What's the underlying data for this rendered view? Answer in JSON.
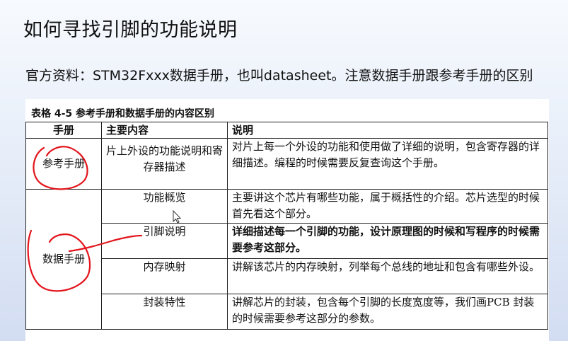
{
  "slide": {
    "title": "如何寻找引脚的功能说明",
    "subtitle": "官方资料：STM32Fxxx数据手册，也叫datasheet。注意数据手册跟参考手册的区别"
  },
  "table": {
    "caption": "表格 4-5 参考手册和数据手册的内容区别",
    "headers": [
      "手册",
      "主要内容",
      "说明"
    ],
    "rows": [
      {
        "manual": "参考手册",
        "content": "片上外设的功能说明和寄存器描述",
        "desc": "对片上每一个外设的功能和使用做了详细的说明，包含寄存器的详细描述。编程的时候需要反复查询这个手册。"
      },
      {
        "manual": "数据手册",
        "content": "功能概览",
        "desc": "主要讲这个芯片有哪些功能，属于概括性的介绍。芯片选型的时候首先看这个部分。"
      },
      {
        "content": "引脚说明",
        "desc": "详细描述每一个引脚的功能，设计原理图的时候和写程序的时候需要参考这部分。"
      },
      {
        "content": "内存映射",
        "desc": "讲解该芯片的内存映射，列举每个总线的地址和包含有哪些外设。"
      },
      {
        "content": "封装特性",
        "desc": "讲解芯片的封装，包含每个引脚的长度宽度等，我们画PCB 封装的时候需要参考这部分的参数。"
      }
    ]
  },
  "annotation": {
    "ink_color": "#e3141b"
  },
  "cursor": {
    "icon": "mouse-pointer-icon"
  }
}
